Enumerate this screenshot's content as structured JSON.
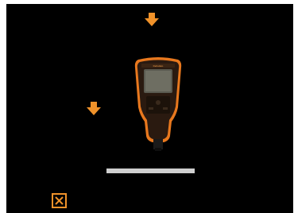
{
  "colors": {
    "screen_bg": "#000000",
    "accent": "#f0922a",
    "baseline": "#cfcfcf"
  },
  "icons": {
    "top_arrow": "arrow-down-icon",
    "left_arrow": "arrow-down-icon",
    "device": "coating-gauge-device-icon",
    "close": "close-icon"
  },
  "device": {
    "brand_text": "DeFelsko"
  }
}
